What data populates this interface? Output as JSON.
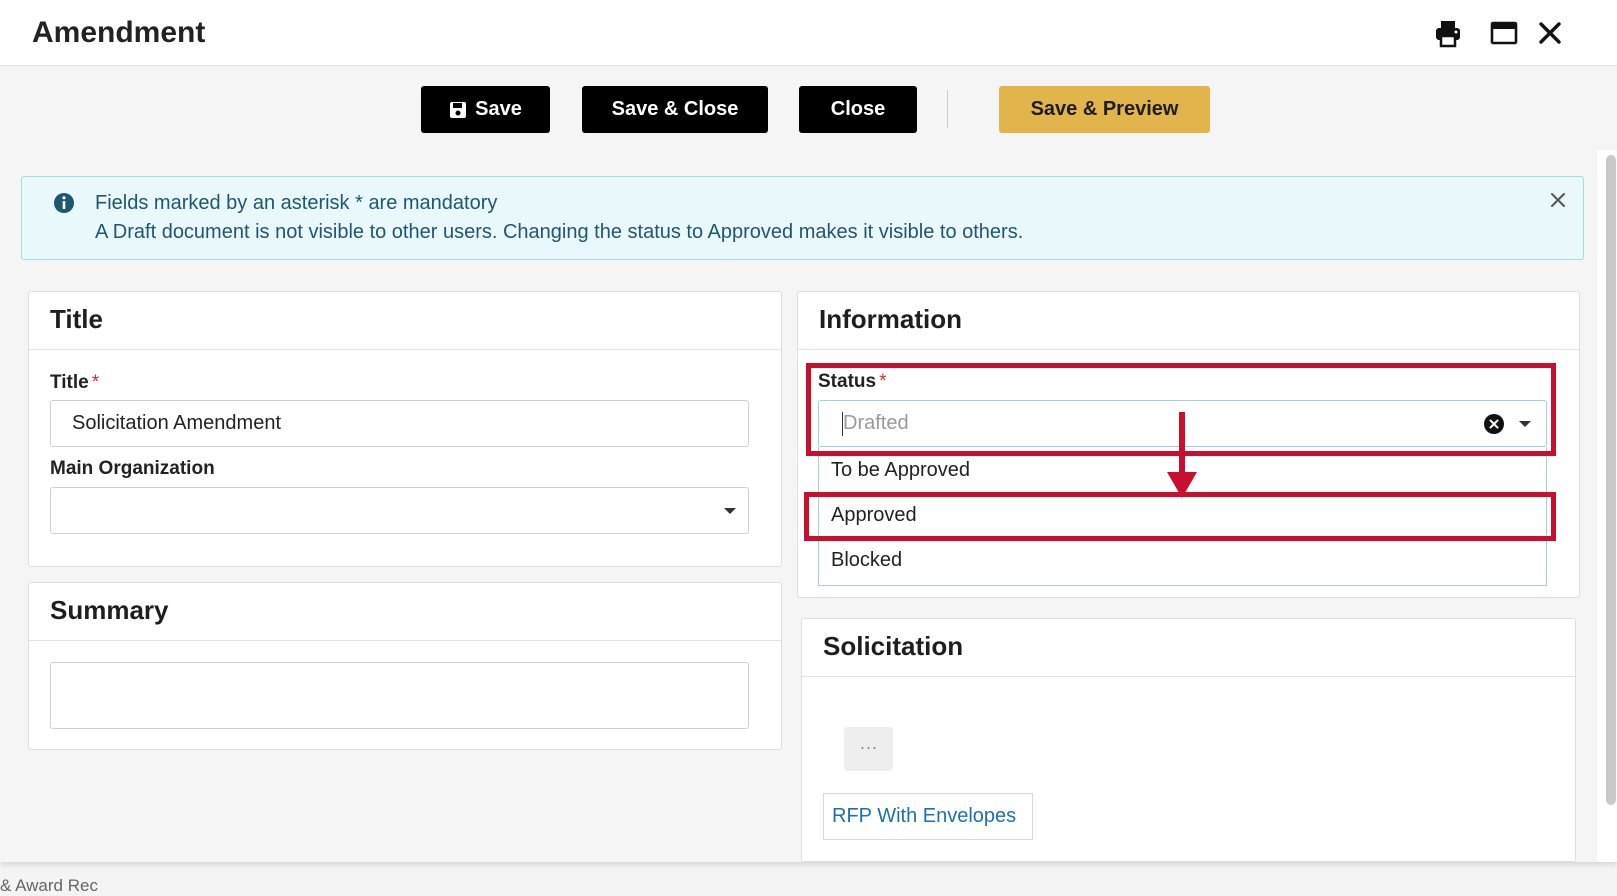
{
  "window": {
    "title": "Amendment",
    "icons": [
      "print-icon",
      "maximize-icon",
      "close-icon"
    ]
  },
  "toolbar": {
    "save_label": "Save",
    "save_close_label": "Save & Close",
    "close_label": "Close",
    "save_preview_label": "Save & Preview"
  },
  "alert": {
    "line1": "Fields marked by an asterisk * are mandatory",
    "line2": "A Draft document is not visible to other users. Changing the status to Approved makes it visible to others."
  },
  "title_card": {
    "heading": "Title",
    "title_label": "Title",
    "title_required": "*",
    "title_value": "Solicitation Amendment",
    "org_label": "Main Organization",
    "org_value": ""
  },
  "summary_card": {
    "heading": "Summary",
    "value": ""
  },
  "information_card": {
    "heading": "Information",
    "status_label": "Status",
    "status_required": "*",
    "status_placeholder": "Drafted",
    "options": [
      "To be Approved",
      "Approved",
      "Blocked"
    ],
    "highlighted_option": "Approved"
  },
  "solicitation_card": {
    "heading": "Solicitation",
    "more_label": "···",
    "link_label": "RFP With Envelopes"
  },
  "background": {
    "partial_text": "& Award Rec"
  },
  "colors": {
    "primary_button": "#000000",
    "accent_button": "#e1b44c",
    "annotation": "#c8102e",
    "link": "#1f6fb0",
    "alert_bg": "#e9f8fb"
  }
}
